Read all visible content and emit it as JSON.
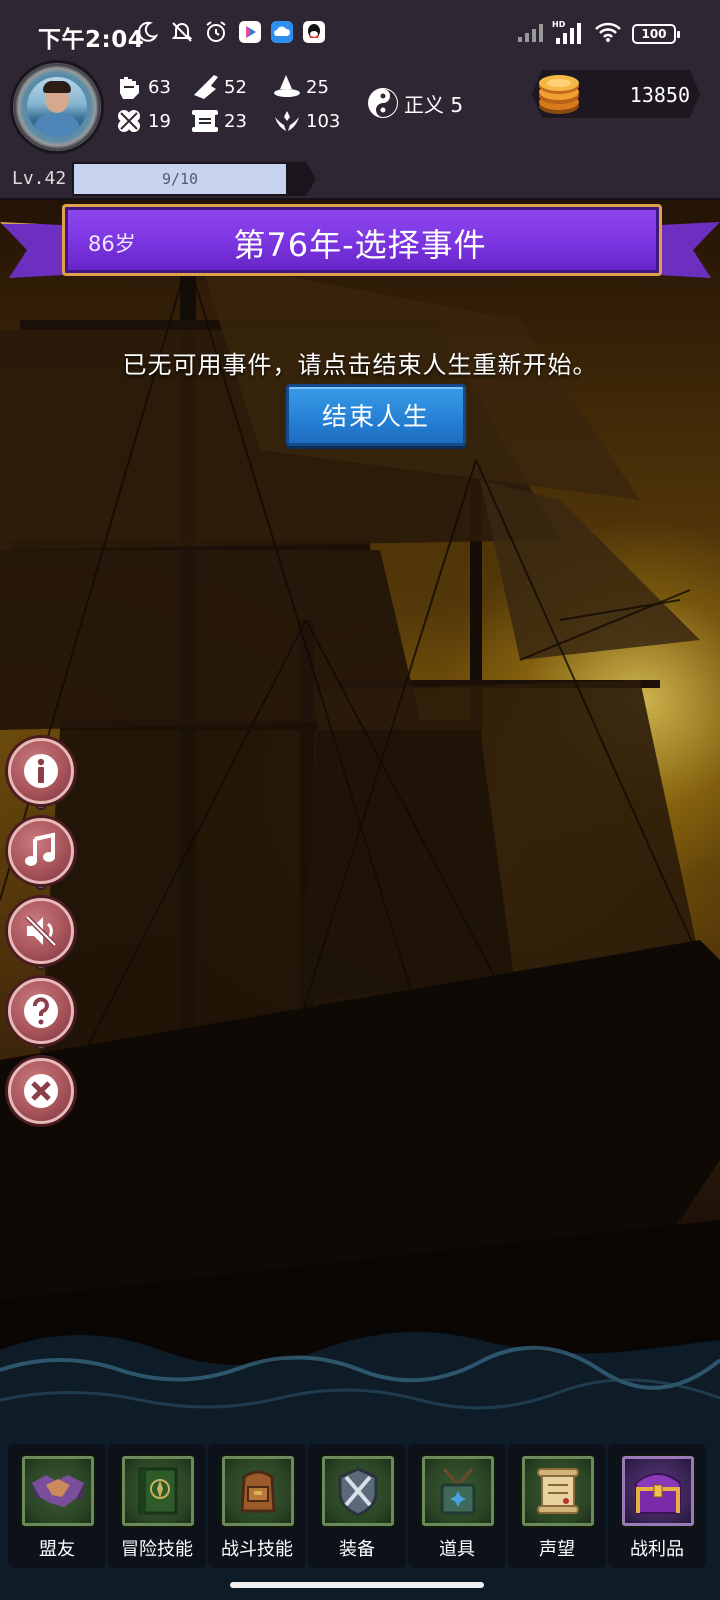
{
  "status_bar": {
    "time": "下午2:04",
    "battery": "100",
    "left_icons": [
      "moon-icon",
      "mute-bell-icon",
      "alarm-icon",
      "play-app-icon",
      "cloud-app-icon",
      "qq-icon"
    ],
    "right_icons": [
      "signal-icon",
      "hd-signal-icon",
      "wifi-icon",
      "battery-icon"
    ]
  },
  "player": {
    "level_label": "Lv.42",
    "xp_text": "9/10",
    "xp_fraction": 0.9,
    "stats": [
      {
        "icon": "fist-icon",
        "value": "63"
      },
      {
        "icon": "book-quill-icon",
        "value": "52"
      },
      {
        "icon": "wizard-hat-icon",
        "value": "25"
      },
      {
        "icon": "clover-icon",
        "value": "19"
      },
      {
        "icon": "scroll-icon",
        "value": "23"
      },
      {
        "icon": "laurel-icon",
        "value": "103"
      }
    ],
    "justice": {
      "icon": "yin-yang-icon",
      "label": "正义 5"
    },
    "gold": {
      "icon": "gold-coins-icon",
      "value": "13850"
    }
  },
  "event": {
    "age": "86岁",
    "title": "第76年-选择事件",
    "message": "已无可用事件，请点击结束人生重新开始。",
    "end_button": "结束人生"
  },
  "side_menu": [
    {
      "name": "info-button",
      "icon": "info-icon"
    },
    {
      "name": "music-button",
      "icon": "music-note-icon"
    },
    {
      "name": "sound-button",
      "icon": "mute-icon"
    },
    {
      "name": "help-button",
      "icon": "question-icon"
    },
    {
      "name": "close-button",
      "icon": "close-icon"
    }
  ],
  "bottom_nav": [
    {
      "label": "盟友",
      "icon": "handshake-icon"
    },
    {
      "label": "冒险技能",
      "icon": "spellbook-icon"
    },
    {
      "label": "战斗技能",
      "icon": "backpack-icon"
    },
    {
      "label": "装备",
      "icon": "crossed-swords-icon"
    },
    {
      "label": "道具",
      "icon": "satchel-icon"
    },
    {
      "label": "声望",
      "icon": "parchment-icon"
    },
    {
      "label": "战利品",
      "icon": "treasure-chest-icon"
    }
  ],
  "colors": {
    "banner": "#7a34e0",
    "banner_border": "#e3a04a",
    "end_button": "#2580d4",
    "side_button": "#a8545b",
    "hud_background": "#2e2632"
  }
}
